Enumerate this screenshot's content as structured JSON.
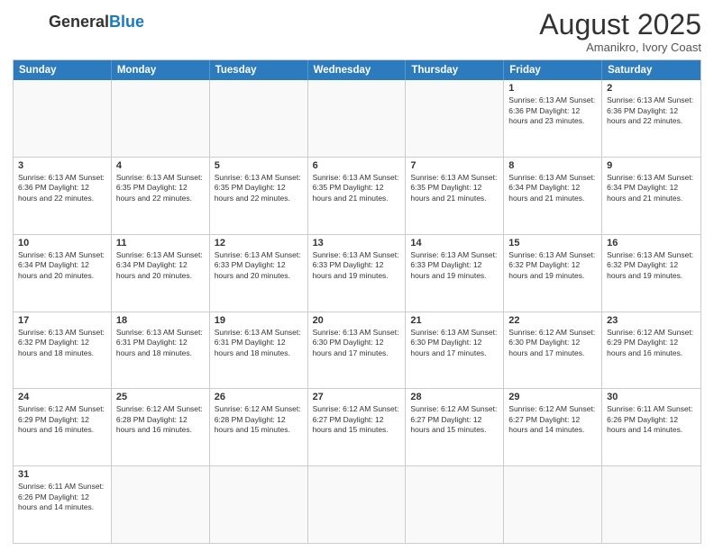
{
  "logo": {
    "text_general": "General",
    "text_blue": "Blue"
  },
  "title": "August 2025",
  "location": "Amanikro, Ivory Coast",
  "header_days": [
    "Sunday",
    "Monday",
    "Tuesday",
    "Wednesday",
    "Thursday",
    "Friday",
    "Saturday"
  ],
  "weeks": [
    [
      {
        "day": "",
        "info": "",
        "empty": true
      },
      {
        "day": "",
        "info": "",
        "empty": true
      },
      {
        "day": "",
        "info": "",
        "empty": true
      },
      {
        "day": "",
        "info": "",
        "empty": true
      },
      {
        "day": "",
        "info": "",
        "empty": true
      },
      {
        "day": "1",
        "info": "Sunrise: 6:13 AM\nSunset: 6:36 PM\nDaylight: 12 hours and 23 minutes."
      },
      {
        "day": "2",
        "info": "Sunrise: 6:13 AM\nSunset: 6:36 PM\nDaylight: 12 hours and 22 minutes."
      }
    ],
    [
      {
        "day": "3",
        "info": "Sunrise: 6:13 AM\nSunset: 6:36 PM\nDaylight: 12 hours and 22 minutes."
      },
      {
        "day": "4",
        "info": "Sunrise: 6:13 AM\nSunset: 6:35 PM\nDaylight: 12 hours and 22 minutes."
      },
      {
        "day": "5",
        "info": "Sunrise: 6:13 AM\nSunset: 6:35 PM\nDaylight: 12 hours and 22 minutes."
      },
      {
        "day": "6",
        "info": "Sunrise: 6:13 AM\nSunset: 6:35 PM\nDaylight: 12 hours and 21 minutes."
      },
      {
        "day": "7",
        "info": "Sunrise: 6:13 AM\nSunset: 6:35 PM\nDaylight: 12 hours and 21 minutes."
      },
      {
        "day": "8",
        "info": "Sunrise: 6:13 AM\nSunset: 6:34 PM\nDaylight: 12 hours and 21 minutes."
      },
      {
        "day": "9",
        "info": "Sunrise: 6:13 AM\nSunset: 6:34 PM\nDaylight: 12 hours and 21 minutes."
      }
    ],
    [
      {
        "day": "10",
        "info": "Sunrise: 6:13 AM\nSunset: 6:34 PM\nDaylight: 12 hours and 20 minutes."
      },
      {
        "day": "11",
        "info": "Sunrise: 6:13 AM\nSunset: 6:34 PM\nDaylight: 12 hours and 20 minutes."
      },
      {
        "day": "12",
        "info": "Sunrise: 6:13 AM\nSunset: 6:33 PM\nDaylight: 12 hours and 20 minutes."
      },
      {
        "day": "13",
        "info": "Sunrise: 6:13 AM\nSunset: 6:33 PM\nDaylight: 12 hours and 19 minutes."
      },
      {
        "day": "14",
        "info": "Sunrise: 6:13 AM\nSunset: 6:33 PM\nDaylight: 12 hours and 19 minutes."
      },
      {
        "day": "15",
        "info": "Sunrise: 6:13 AM\nSunset: 6:32 PM\nDaylight: 12 hours and 19 minutes."
      },
      {
        "day": "16",
        "info": "Sunrise: 6:13 AM\nSunset: 6:32 PM\nDaylight: 12 hours and 19 minutes."
      }
    ],
    [
      {
        "day": "17",
        "info": "Sunrise: 6:13 AM\nSunset: 6:32 PM\nDaylight: 12 hours and 18 minutes."
      },
      {
        "day": "18",
        "info": "Sunrise: 6:13 AM\nSunset: 6:31 PM\nDaylight: 12 hours and 18 minutes."
      },
      {
        "day": "19",
        "info": "Sunrise: 6:13 AM\nSunset: 6:31 PM\nDaylight: 12 hours and 18 minutes."
      },
      {
        "day": "20",
        "info": "Sunrise: 6:13 AM\nSunset: 6:30 PM\nDaylight: 12 hours and 17 minutes."
      },
      {
        "day": "21",
        "info": "Sunrise: 6:13 AM\nSunset: 6:30 PM\nDaylight: 12 hours and 17 minutes."
      },
      {
        "day": "22",
        "info": "Sunrise: 6:12 AM\nSunset: 6:30 PM\nDaylight: 12 hours and 17 minutes."
      },
      {
        "day": "23",
        "info": "Sunrise: 6:12 AM\nSunset: 6:29 PM\nDaylight: 12 hours and 16 minutes."
      }
    ],
    [
      {
        "day": "24",
        "info": "Sunrise: 6:12 AM\nSunset: 6:29 PM\nDaylight: 12 hours and 16 minutes."
      },
      {
        "day": "25",
        "info": "Sunrise: 6:12 AM\nSunset: 6:28 PM\nDaylight: 12 hours and 16 minutes."
      },
      {
        "day": "26",
        "info": "Sunrise: 6:12 AM\nSunset: 6:28 PM\nDaylight: 12 hours and 15 minutes."
      },
      {
        "day": "27",
        "info": "Sunrise: 6:12 AM\nSunset: 6:27 PM\nDaylight: 12 hours and 15 minutes."
      },
      {
        "day": "28",
        "info": "Sunrise: 6:12 AM\nSunset: 6:27 PM\nDaylight: 12 hours and 15 minutes."
      },
      {
        "day": "29",
        "info": "Sunrise: 6:12 AM\nSunset: 6:27 PM\nDaylight: 12 hours and 14 minutes."
      },
      {
        "day": "30",
        "info": "Sunrise: 6:11 AM\nSunset: 6:26 PM\nDaylight: 12 hours and 14 minutes."
      }
    ],
    [
      {
        "day": "31",
        "info": "Sunrise: 6:11 AM\nSunset: 6:26 PM\nDaylight: 12 hours and 14 minutes."
      },
      {
        "day": "",
        "info": "",
        "empty": true
      },
      {
        "day": "",
        "info": "",
        "empty": true
      },
      {
        "day": "",
        "info": "",
        "empty": true
      },
      {
        "day": "",
        "info": "",
        "empty": true
      },
      {
        "day": "",
        "info": "",
        "empty": true
      },
      {
        "day": "",
        "info": "",
        "empty": true
      }
    ]
  ]
}
